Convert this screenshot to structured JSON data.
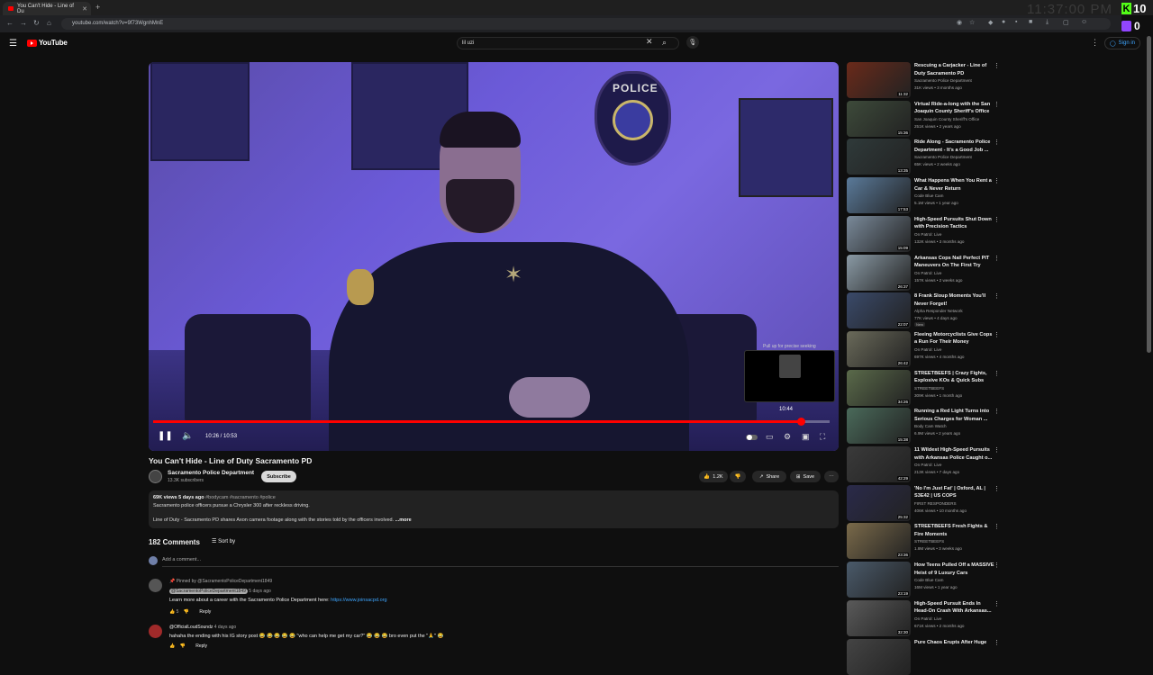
{
  "browser": {
    "tab_title": "You Can't Hide - Line of Du",
    "url": "youtube.com/watch?v=9f73WgnhMnE",
    "overlay_clock": "11:37:00 PM",
    "kick_count": "10",
    "twitch_count": "0"
  },
  "header": {
    "logo_text": "YouTube",
    "search_value": "lil uzi",
    "sign_in_label": "Sign in"
  },
  "player": {
    "time_display": "10:26 / 10:53",
    "preview_hint": "Pull up for precise seeking",
    "preview_time": "10:44",
    "progress": 0.958
  },
  "video": {
    "title": "You Can't Hide - Line of Duty Sacramento PD",
    "channel": "Sacramento Police Department",
    "subscribers": "13.3K subscribers",
    "subscribe_label": "Subscribe",
    "likes": "1.2K",
    "share_label": "Share",
    "save_label": "Save",
    "views_age": "69K views  5 days ago",
    "hashtags": "#bodycam #sacramento #police",
    "desc_line1": "Sacramento police officers pursue a Chrysler 300 after reckless driving.",
    "desc_line2": "Line of Duty - Sacramento PD shares Axon camera footage along with the stories told by the officers involved.",
    "more_label": "...more"
  },
  "comments": {
    "count_label": "182 Comments",
    "sort_label": "Sort by",
    "add_placeholder": "Add a comment...",
    "items": [
      {
        "pinned": "Pinned by @SacramentoPoliceDepartment1849",
        "author": "@SacramentoPoliceDepartment1849",
        "age": "5 days ago",
        "text": "Learn more about a career with the Sacramento Police Department here: ",
        "link": "https://www.joinsacpd.org",
        "likes": "5",
        "reply_label": "Reply"
      },
      {
        "author": "@OfficialLoudSoundz",
        "age": "4 days ago",
        "text": "hahaha the ending with his IG story post 😂 😂 😂 😂 😂  \"who can help me get my car?\" 😂 😂 😂 bro even put the \"🙏\" 😂",
        "likes": "",
        "reply_label": "Reply"
      }
    ]
  },
  "recommendations": [
    {
      "title": "Rescuing a Carjacker - Line of Duty Sacramento PD",
      "channel": "Sacramento Police Department",
      "stats": "31K views • 3 months ago",
      "duration": "11:32",
      "color": "#6a2a1a"
    },
    {
      "title": "Virtual Ride-a-long with the San Joaquin County Sheriff's Office",
      "channel": "San Joaquin County Sheriff's Office",
      "stats": "251K views • 2 years ago",
      "duration": "15:36",
      "color": "#3d4a3a"
    },
    {
      "title": "Ride Along - Sacramento Police Department - It's a Good Job ...",
      "channel": "Sacramento Police Department",
      "stats": "65K views • 2 weeks ago",
      "duration": "13:35",
      "color": "#2f3a3a"
    },
    {
      "title": "What Happens When You Rent a Car & Never Return",
      "channel": "Code Blue Cam",
      "stats": "5.1M views • 1 year ago",
      "duration": "17:53",
      "color": "#5a7a9a"
    },
    {
      "title": "High-Speed Pursuits Shut Down with Precision Tactics",
      "channel": "On Patrol: Live",
      "stats": "132K views • 3 months ago",
      "duration": "15:09",
      "color": "#7a8a9a"
    },
    {
      "title": "Arkansas Cops Nail Perfect PIT Maneuvers On The First Try",
      "channel": "On Patrol: Live",
      "stats": "157K views • 2 weeks ago",
      "duration": "26:37",
      "color": "#8a9aa5"
    },
    {
      "title": "8 Frank Sloup Moments You'll Never Forget!",
      "channel": "Alpha Responder Network",
      "stats": "77K views • 4 days ago",
      "duration": "22:07",
      "color": "#3a4a6a",
      "badge": "New"
    },
    {
      "title": "Fleeing Motorcyclists Give Cops a Run For Their Money",
      "channel": "On Patrol: Live",
      "stats": "697K views • 4 months ago",
      "duration": "26:42",
      "color": "#6a6a5a"
    },
    {
      "title": "STREETBEEFS | Crazy Fights, Explosive KOs & Quick Subs",
      "channel": "STREETBEEFS",
      "stats": "309K views • 1 month ago",
      "duration": "34:26",
      "color": "#5a6a4a"
    },
    {
      "title": "Running a Red Light Turns into Serious Charges for Woman ...",
      "channel": "Body Cam Watch",
      "stats": "6.9M views • 2 years ago",
      "duration": "15:38",
      "color": "#4a6a5a"
    },
    {
      "title": "11 Wildest High-Speed Pursuits with Arkansas Police Caught o...",
      "channel": "On Patrol: Live",
      "stats": "213K views • 7 days ago",
      "duration": "42:29",
      "color": "#3a3a3a"
    },
    {
      "title": "'No I'm Just Fat' | Oxford, AL | S3E42 | US COPS",
      "channel": "FIRST RESPONDERS",
      "stats": "406K views • 10 months ago",
      "duration": "25:32",
      "color": "#2a2a4a"
    },
    {
      "title": "STREETBEEFS Fresh Fights & Fire Moments",
      "channel": "STREETBEEFS",
      "stats": "1.8M views • 3 weeks ago",
      "duration": "23:36",
      "color": "#7a6a4a"
    },
    {
      "title": "How Teens Pulled Off a MASSIVE Heist of 9 Luxury Cars",
      "channel": "Code Blue Cam",
      "stats": "16M views • 1 year ago",
      "duration": "23:19",
      "color": "#4a5a6a"
    },
    {
      "title": "High-Speed Pursuit Ends In Head-On Crash With Arkansas...",
      "channel": "On Patrol: Live",
      "stats": "671K views • 2 months ago",
      "duration": "32:30",
      "color": "#5a5a5a"
    },
    {
      "title": "Pure Chaos Erupts After Huge",
      "channel": "",
      "stats": "",
      "duration": "",
      "color": "#444"
    }
  ]
}
